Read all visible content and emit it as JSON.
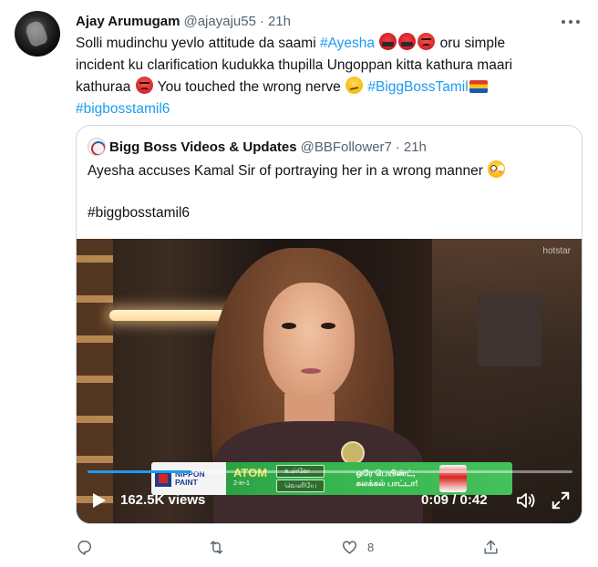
{
  "tweet": {
    "author_name": "Ajay Arumugam",
    "handle": "@ajayaju55",
    "separator": "·",
    "time": "21h",
    "text_line1_a": "Solli mudinchu yevlo attitude da saami ",
    "hashtag_ayesha": "#Ayesha",
    "text_line1_b": " oru simple",
    "text_line2": "incident ku clarification kudukka thupilla Ungoppan kitta kathura maari",
    "text_line3_a": "kathuraa ",
    "text_line3_b": " You touched the wrong nerve ",
    "hashtag_bbt": "#BiggBossTamil",
    "hashtag_bbt6": "#bigbosstamil6"
  },
  "quote": {
    "author_name": "Bigg Boss Videos & Updates",
    "handle": "@BBFollower7",
    "separator": "·",
    "time": "21h",
    "text": "Ayesha accuses Kamal Sir of portraying her in a wrong manner ",
    "hashtag": "#biggbosstamil6"
  },
  "video": {
    "watermark": "hotstar",
    "views": "162.5K views",
    "time_readout": "0:09 / 0:42",
    "progress": 0.2143,
    "ad": {
      "brand_line1": "NIPPON",
      "brand_line2": "PAINT",
      "product": "ATOM",
      "product_sub": "2-in-1",
      "arrow_top": "உள்ளே",
      "arrow_bottom": "வெளியே",
      "tagline_line1": "ஒரே பெயிண்ட்,",
      "tagline_line2": "கலக்கல் பாட்டா!"
    }
  },
  "actions": {
    "reply_count": "",
    "retweet_count": "",
    "like_count": "8",
    "share_count": ""
  },
  "icons": [
    "more-icon",
    "play-icon",
    "volume-icon",
    "fullscreen-icon",
    "reply-icon",
    "retweet-icon",
    "like-icon",
    "share-icon"
  ],
  "colors": {
    "link": "#1d9bf0",
    "secondary_text": "#536471",
    "border": "#cfd9de"
  }
}
